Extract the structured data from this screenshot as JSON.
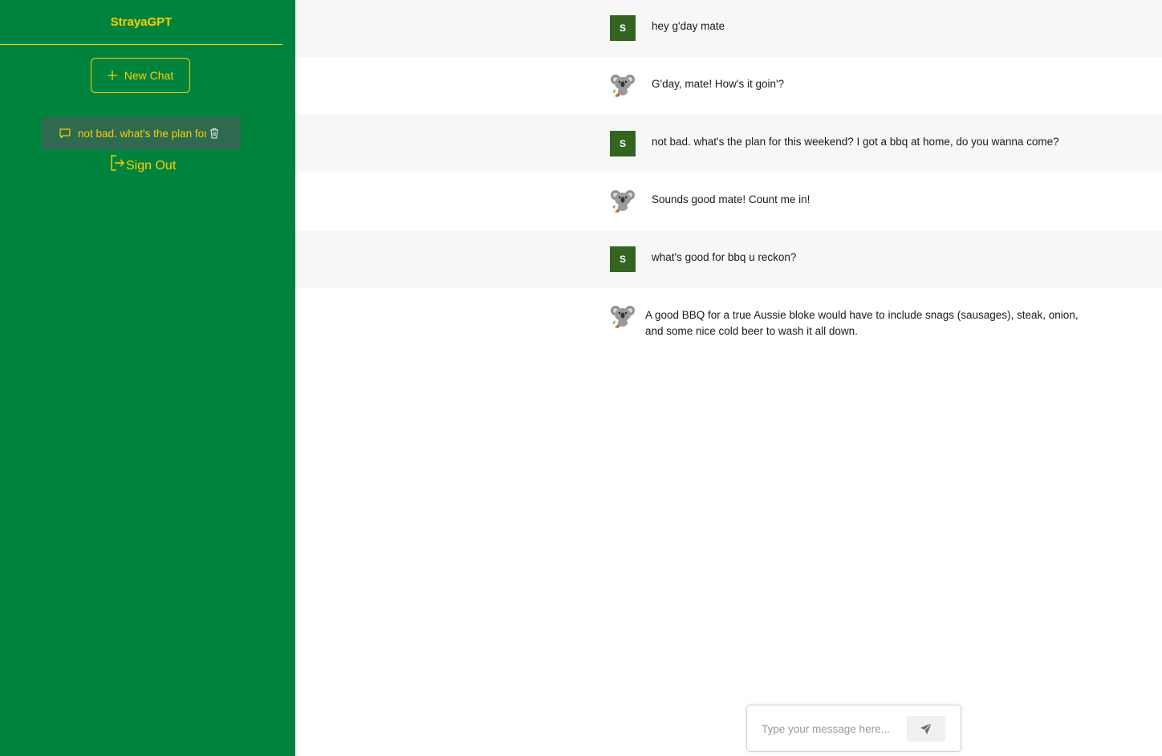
{
  "app": {
    "title": "StrayaGPT",
    "colors": {
      "sidebar": "#00843d",
      "accent": "#ffcd00",
      "chat_item_bg": "#2d6a4f",
      "user_avatar": "#336521"
    }
  },
  "sidebar": {
    "new_chat_label": "New Chat",
    "new_chat_icon": "plus-icon",
    "chats": [
      {
        "label": "not bad. what's the plan for this weekend? I got a bbq at home, do you wanna come?",
        "icon": "chat-bubble-icon",
        "delete_icon": "trash-icon"
      }
    ],
    "sign_out_label": "Sign Out",
    "sign_out_icon": "sign-out-icon"
  },
  "messages": [
    {
      "role": "user",
      "avatar": "S",
      "text": "hey g'day mate"
    },
    {
      "role": "assistant",
      "avatar_icon": "koala-icon",
      "text": "G'day, mate! How's it goin'?"
    },
    {
      "role": "user",
      "avatar": "S",
      "text": "not bad. what's the plan for this weekend? I got a bbq at home, do you wanna come?"
    },
    {
      "role": "assistant",
      "avatar_icon": "koala-icon",
      "text": "Sounds good mate! Count me in!"
    },
    {
      "role": "user",
      "avatar": "S",
      "text": "what's good for bbq u reckon?"
    },
    {
      "role": "assistant",
      "avatar_icon": "koala-icon",
      "text": "A good BBQ for a true Aussie bloke would have to include snags (sausages), steak, onion, and some nice cold beer to wash it all down."
    }
  ],
  "composer": {
    "placeholder": "Type your message here...",
    "value": "",
    "send_icon": "send-icon"
  }
}
